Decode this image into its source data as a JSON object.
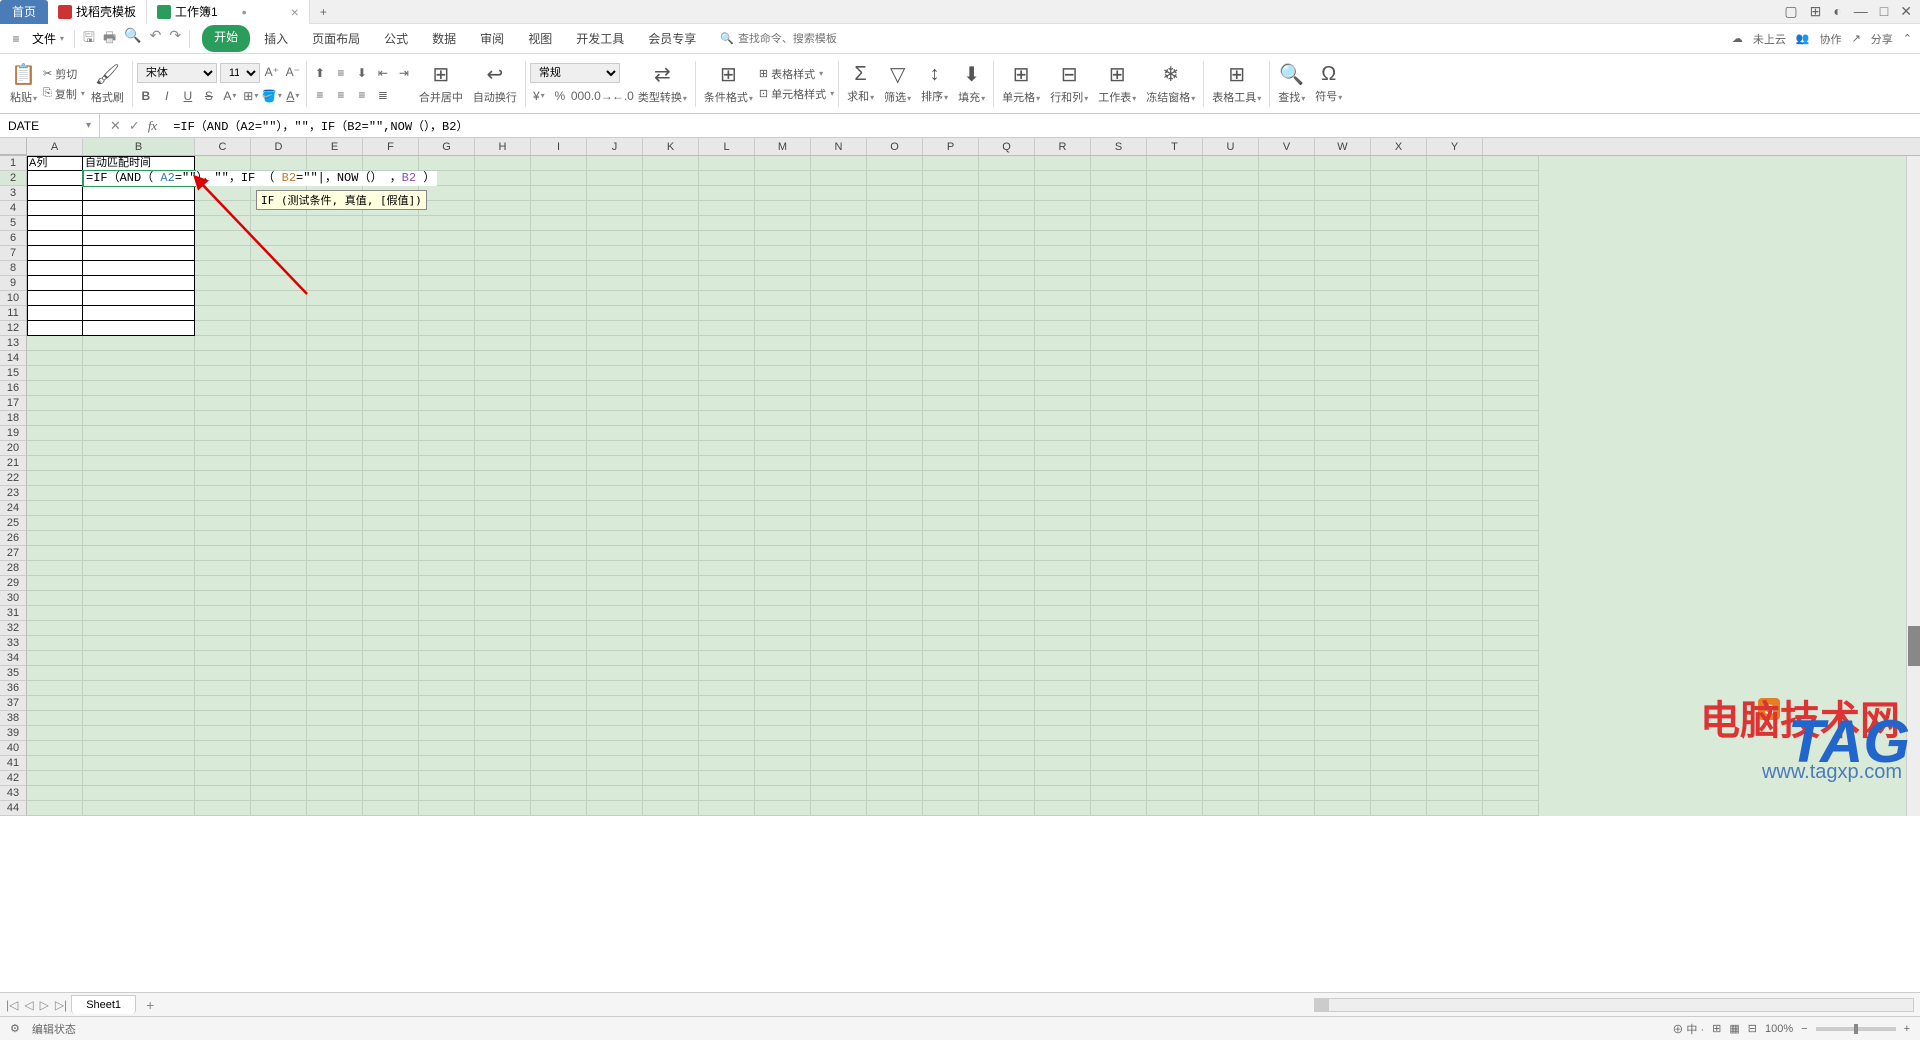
{
  "titlebar": {
    "home_tab": "首页",
    "template_tab": "找稻壳模板",
    "doc_tab": "工作簿1"
  },
  "menu": {
    "file": "文件",
    "tabs": [
      "开始",
      "插入",
      "页面布局",
      "公式",
      "数据",
      "审阅",
      "视图",
      "开发工具",
      "会员专享"
    ],
    "active_tab_index": 0,
    "search_placeholder": "查找命令、搜索模板",
    "cloud": "未上云",
    "cooperate": "协作",
    "share": "分享"
  },
  "ribbon": {
    "paste": "粘贴",
    "cut": "剪切",
    "copy": "复制",
    "brush": "格式刷",
    "font_name": "宋体",
    "font_size": "11",
    "merge": "合并居中",
    "wrap": "自动换行",
    "numfmt": "常规",
    "type_convert": "类型转换",
    "cond_fmt": "条件格式",
    "table_style": "表格样式",
    "cell_style": "单元格样式",
    "sum": "求和",
    "filter": "筛选",
    "sort": "排序",
    "fill": "填充",
    "cell": "单元格",
    "rowcol": "行和列",
    "worksheet": "工作表",
    "freeze": "冻结窗格",
    "tools": "表格工具",
    "find": "查找",
    "symbol": "符号"
  },
  "formula_bar": {
    "name": "DATE",
    "formula": "=IF（AND（A2=\"\"），\"\"，IF（B2=\"\",NOW（），B2）"
  },
  "columns": [
    "A",
    "B",
    "C",
    "D",
    "E",
    "F",
    "G",
    "H",
    "I",
    "J",
    "K",
    "L",
    "M",
    "N",
    "O",
    "P",
    "Q",
    "R",
    "S",
    "T",
    "U",
    "V",
    "W",
    "X",
    "Y"
  ],
  "cells": {
    "a1": "A列",
    "b1": "自动匹配时间",
    "b2_display": "=IF（AND（ A2=\"\"），\"\"，IF （ B2=\"\"|，NOW（） ，B2 ）",
    "b2_parts": {
      "p1": "=IF（AND（ ",
      "a2": "A2",
      "p2": "=\"\"），\"\"，IF （ ",
      "b2a": "B2",
      "p3": "=\"\"|，NOW（） ，",
      "b2b": "B2",
      "p4": " ）"
    }
  },
  "tooltip": "IF (测试条件, 真值, [假值])",
  "sheet": {
    "name": "Sheet1"
  },
  "status": {
    "mode": "编辑状态",
    "zoom": "100%"
  },
  "watermarks": {
    "site_name": "电脑技术网",
    "site_url": "www.tagxp.com",
    "tag": "TAG",
    "s_icon": "S"
  }
}
